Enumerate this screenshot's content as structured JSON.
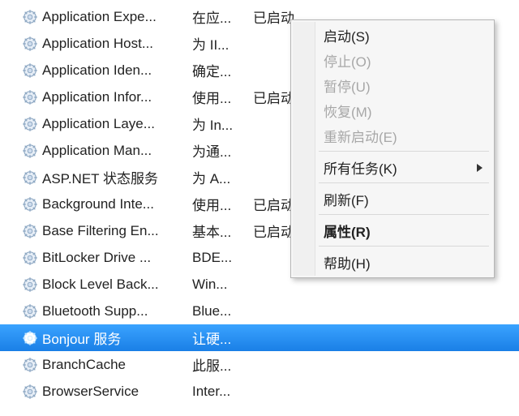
{
  "services": [
    {
      "name": "Application Expe...",
      "desc": "在应...",
      "status": "已启动",
      "selected": false
    },
    {
      "name": "Application Host...",
      "desc": "为 II...",
      "status": "",
      "selected": false
    },
    {
      "name": "Application Iden...",
      "desc": "确定...",
      "status": "",
      "selected": false
    },
    {
      "name": "Application Infor...",
      "desc": "使用...",
      "status": "已启动",
      "selected": false
    },
    {
      "name": "Application Laye...",
      "desc": "为 In...",
      "status": "",
      "selected": false
    },
    {
      "name": "Application Man...",
      "desc": "为通...",
      "status": "",
      "selected": false
    },
    {
      "name": "ASP.NET 状态服务",
      "desc": "为 A...",
      "status": "",
      "selected": false
    },
    {
      "name": "Background Inte...",
      "desc": "使用...",
      "status": "已启动",
      "selected": false
    },
    {
      "name": "Base Filtering En...",
      "desc": "基本...",
      "status": "已启动",
      "selected": false
    },
    {
      "name": "BitLocker Drive ...",
      "desc": "BDE...",
      "status": "",
      "selected": false
    },
    {
      "name": "Block Level Back...",
      "desc": "Win...",
      "status": "",
      "selected": false
    },
    {
      "name": "Bluetooth Supp...",
      "desc": "Blue...",
      "status": "",
      "selected": false
    },
    {
      "name": "Bonjour 服务",
      "desc": "让硬...",
      "status": "",
      "selected": true
    },
    {
      "name": "BranchCache",
      "desc": "此服...",
      "status": "",
      "selected": false
    },
    {
      "name": "BrowserService",
      "desc": "Inter...",
      "status": "",
      "selected": false
    }
  ],
  "menu": {
    "start": "启动(S)",
    "stop": "停止(O)",
    "pause": "暂停(U)",
    "resume": "恢复(M)",
    "restart": "重新启动(E)",
    "all_tasks": "所有任务(K)",
    "refresh": "刷新(F)",
    "properties": "属性(R)",
    "help": "帮助(H)"
  }
}
